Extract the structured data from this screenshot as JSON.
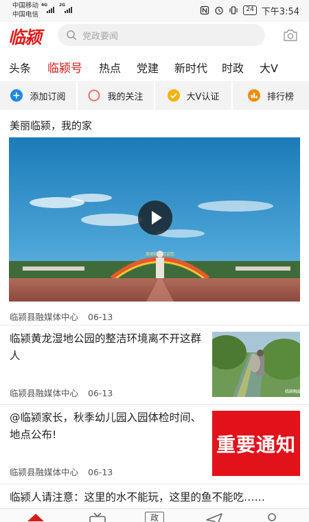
{
  "status_bar": {
    "carrier_1": "中国移动",
    "carrier_2": "中国电信",
    "net_1": "4G",
    "net_2": "2G",
    "battery": "24",
    "time": "下午3:54"
  },
  "header": {
    "logo": "临颍",
    "search_placeholder": "党政要闻",
    "icons": {
      "search": "search-icon",
      "camera": "camera-icon"
    }
  },
  "tabs": [
    {
      "label": "头条",
      "active": false
    },
    {
      "label": "临颍号",
      "active": true
    },
    {
      "label": "热点",
      "active": false
    },
    {
      "label": "党建",
      "active": false
    },
    {
      "label": "新时代",
      "active": false
    },
    {
      "label": "时政",
      "active": false
    },
    {
      "label": "大V",
      "active": false
    }
  ],
  "shortcuts": [
    {
      "label": "添加订阅",
      "icon": "plus-circle-icon",
      "color": "#1e88e5"
    },
    {
      "label": "我的关注",
      "icon": "circle-outline-icon",
      "color": "#e57373"
    },
    {
      "label": "大V认证",
      "icon": "check-circle-icon",
      "color": "#f5b300"
    },
    {
      "label": "排行榜",
      "icon": "ranking-icon",
      "color": "#f08c00"
    }
  ],
  "feed": {
    "section_title": "美丽临颍，我的家",
    "video": {
      "source": "临颍县融媒体中心",
      "date": "06-13",
      "icon": "play-icon",
      "arch_text": "美丽临颍欢迎您"
    },
    "articles": [
      {
        "title": "临颍黄龙湿地公园的整洁环境离不开这群人",
        "source": "临颍县融媒体中心",
        "date": "06-13",
        "thumb_watermark": "临颍融媒"
      },
      {
        "title": "@临颍家长，秋季幼儿园入园体检时间、地点公布!",
        "source": "临颍县融媒体中心",
        "date": "06-13",
        "thumb_text": "重要通知"
      },
      {
        "title": "临颍人请注意：这里的水不能玩，这里的鱼不能吃……"
      }
    ]
  },
  "bottom_nav": {
    "items": [
      {
        "icon": "home-icon"
      },
      {
        "icon": "tv-icon"
      },
      {
        "icon": "government-icon",
        "label": "政"
      },
      {
        "icon": "send-icon"
      },
      {
        "icon": "user-icon"
      }
    ]
  },
  "colors": {
    "brand_red": "#d71a1a",
    "shortcut_bg": "#f3f3f3",
    "search_bg": "#f1f1f1"
  }
}
